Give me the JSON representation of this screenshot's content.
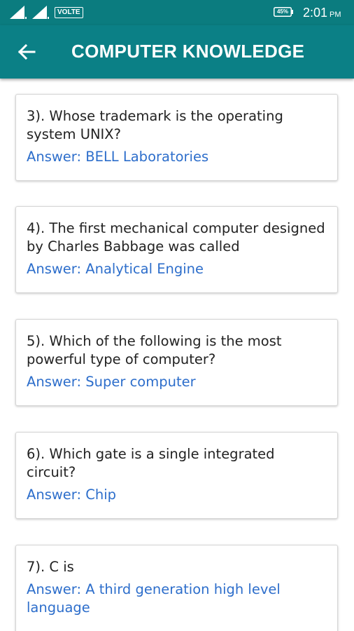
{
  "status_bar": {
    "network_label": "VOLTE",
    "battery_percent": "45%",
    "time": "2:01",
    "ampm": "PM"
  },
  "app_bar": {
    "title": "COMPUTER KNOWLEDGE",
    "back_icon": "arrow-left-icon"
  },
  "colors": {
    "status_bar": "#0b7c7f",
    "app_bar": "#0b8086",
    "answer_text": "#2d6ecb",
    "question_text": "#222222"
  },
  "questions": [
    {
      "question": "3). Whose trademark is the operating system UNIX?",
      "answer": "Answer: BELL Laboratories"
    },
    {
      "question": "4). The first mechanical computer designed by Charles Babbage was called",
      "answer": "Answer: Analytical Engine"
    },
    {
      "question": "5). Which of the following is the most powerful type of computer?",
      "answer": "Answer: Super computer"
    },
    {
      "question": "6). Which gate is a single integrated circuit?",
      "answer": "Answer: Chip"
    },
    {
      "question": "7). C is",
      "answer": "Answer: A third generation high level language"
    }
  ]
}
